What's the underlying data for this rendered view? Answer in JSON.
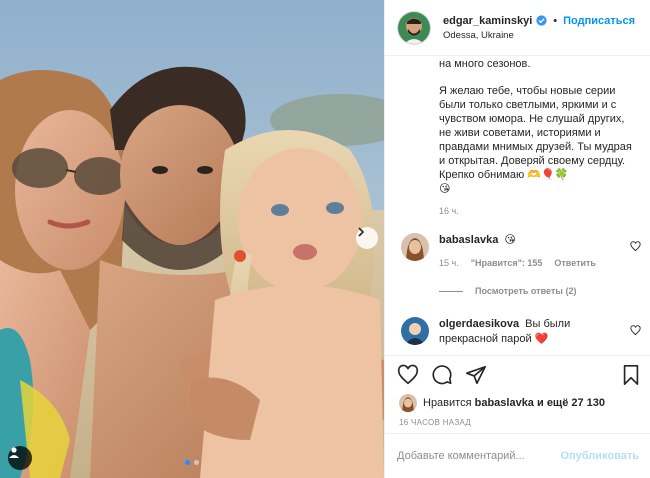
{
  "header": {
    "username": "edgar_kaminskyi",
    "separator": "•",
    "follow_label": "Подписаться",
    "location": "Odessa, Ukraine"
  },
  "caption": {
    "line_top": "на много сезонов.",
    "paragraph": "Я желаю тебе, чтобы новые серии были только светлыми, яркими и с чувством юмора. Не слушай других, не живи советами, историями и правдами мнимых друзей. Ты мудрая и открытая. Доверяй своему сердцу. Крепко обнимаю 🫶🎈🍀",
    "emojis": "😘",
    "time": "16 ч."
  },
  "comments": [
    {
      "username": "babaslavka",
      "text": "😘",
      "time": "15 ч.",
      "likes": "\"Нравится\": 155",
      "reply": "Ответить"
    },
    {
      "username": "olgerdaesikova",
      "text": "Вы были прекрасной парой ❤️"
    }
  ],
  "view_replies": "Посмотреть ответы (2)",
  "likes": {
    "prefix": "Нравится",
    "user": "babaslavka",
    "suffix": "и ещё 27 130"
  },
  "timestamp": "16 ЧАСОВ НАЗАД",
  "comment_box": {
    "placeholder": "Добавьте комментарий...",
    "publish_label": "Опубликовать"
  },
  "colors": {
    "accent": "#0095f6",
    "publish_disabled": "#b2dffc",
    "heart_red": "#ed4956",
    "active_dot": "#1e90ff"
  },
  "carousel": {
    "total": 2,
    "current": 1
  }
}
